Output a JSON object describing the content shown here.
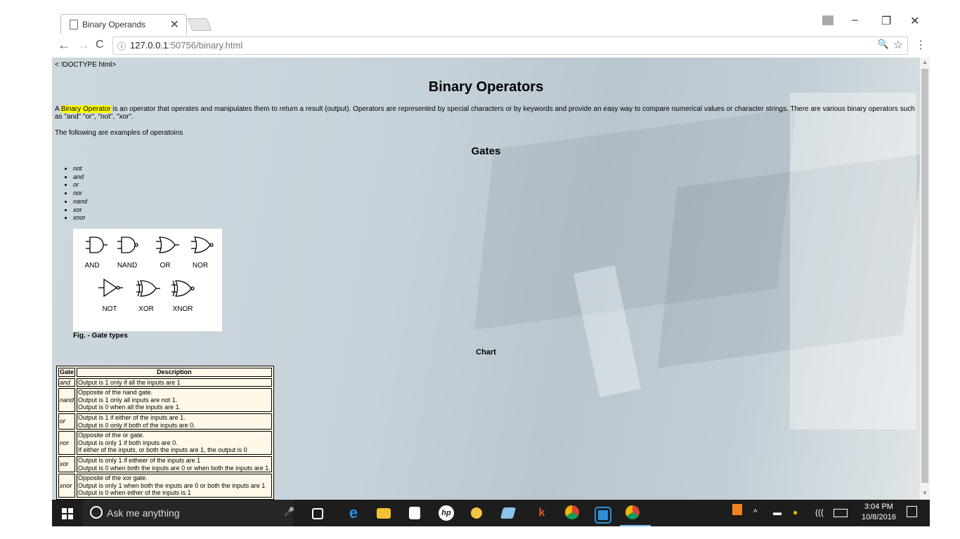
{
  "browser": {
    "tab_title": "Binary Operands",
    "tab_close": "✕",
    "url_info_icon": "ⓘ",
    "url_host": "127.0.0.1",
    "url_path": ":50756/binary.html",
    "zoom_icon": "🔍",
    "star_icon": "☆",
    "menu_icon": "⋮",
    "back": "←",
    "forward": "→",
    "reload": "C",
    "minimize": "–",
    "restore": "❐",
    "close": "✕"
  },
  "page": {
    "doctype": "< !DOCTYPE html>",
    "title": "Binary Operators",
    "intro_prefix": "A ",
    "intro_highlight": "Binary Operator",
    "intro_rest": " is an operator that operates and manipulates them to return a result (output). Operators are represented by special characters or by keywords and provide an easy way to compare numerical values or character strings. There are various binary operators such as \"and\" \"or\", \"not\", \"xor\".",
    "following": "The following are examples of operatoins",
    "gates_heading": "Gates",
    "gates_list": [
      "not",
      "and",
      "or",
      "nor",
      "nand",
      "xor",
      "xnor"
    ],
    "figure_labels": [
      "AND",
      "NAND",
      "OR",
      "NOR",
      "NOT",
      "XOR",
      "XNOR"
    ],
    "figure_caption": "Fig. - Gate types",
    "chart_label": "Chart",
    "table": {
      "headers": [
        "Gate",
        "Description"
      ],
      "rows": [
        {
          "gate": "and",
          "lines": [
            "Output is 1 only if all the inputs are 1"
          ]
        },
        {
          "gate": "nand",
          "lines": [
            "Opposite of the nand gate.",
            "Output is 1 only all inputs are not 1.",
            "Output is 0 when all the inputs are 1."
          ]
        },
        {
          "gate": "or",
          "lines": [
            "Output is 1 if either of the inputs are 1.",
            "Output is 0 only if both of the inputs are 0."
          ]
        },
        {
          "gate": "nor",
          "lines": [
            "Opposite of the or gate.",
            "Output is only 1 if both inputs are 0.",
            "If either of the inputs, or both the inputs are 1, the output is 0"
          ]
        },
        {
          "gate": "xor",
          "lines": [
            "Output is only 1 if eitheer of the inputs are 1",
            "Output is 0 when both the inputs are 0 or when both the inputs are 1."
          ]
        },
        {
          "gate": "xnor",
          "lines": [
            "Opposite of the xor gate.",
            "Output is only 1 when both the inputs are 0 or both the inputs are 1",
            "Output is 0 when either of the inputs is 1"
          ]
        }
      ]
    }
  },
  "taskbar": {
    "search_placeholder": "Ask me anything",
    "time": "3:04 PM",
    "date": "10/8/2016"
  },
  "colors": {
    "highlight": "#ffff00",
    "taskbar": "#1d1d1d"
  }
}
